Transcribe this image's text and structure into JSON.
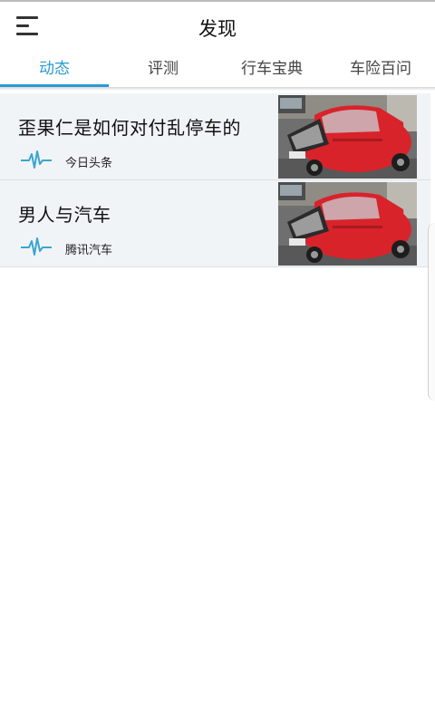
{
  "header": {
    "title": "发现"
  },
  "tabs": [
    {
      "label": "动态"
    },
    {
      "label": "评测"
    },
    {
      "label": "行车宝典"
    },
    {
      "label": "车险百问"
    }
  ],
  "articles": [
    {
      "title": "歪果仁是如何对付乱停车的",
      "source": "今日头条",
      "icon": "pulse-icon",
      "image": "red-car-thumbnail"
    },
    {
      "title": "男人与汽车",
      "source": "腾讯汽车",
      "icon": "pulse-icon",
      "image": "red-car-thumbnail"
    }
  ],
  "colors": {
    "accent": "#2a9bd3",
    "card_bg": "#f1f4f7",
    "car_red": "#d8232b"
  }
}
